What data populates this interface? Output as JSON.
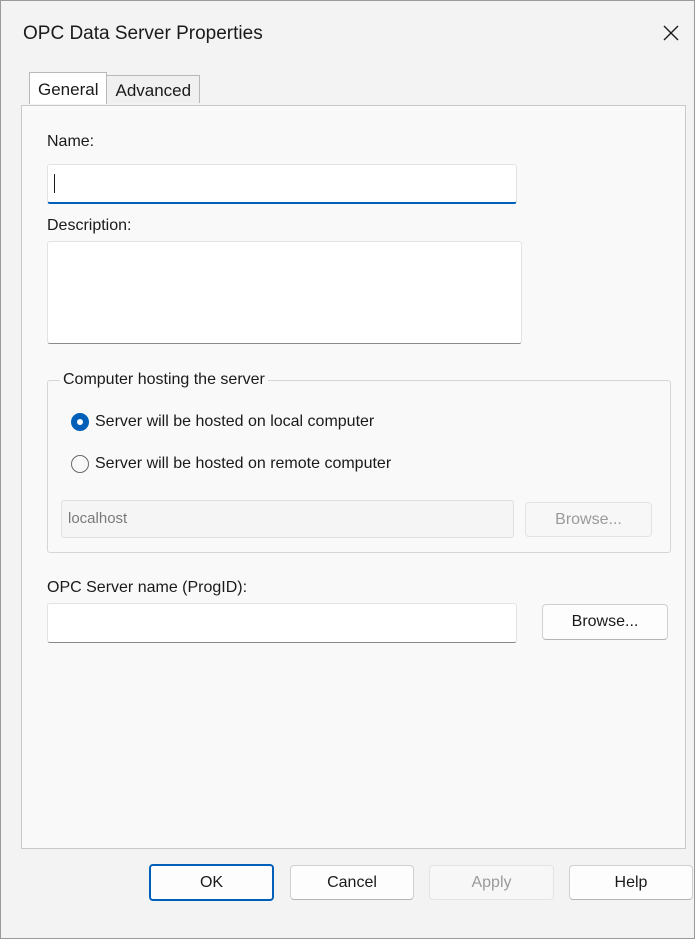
{
  "window": {
    "title": "OPC Data Server Properties",
    "close_glyph": "✕"
  },
  "tabs": [
    {
      "label": "General",
      "active": true
    },
    {
      "label": "Advanced",
      "active": false
    }
  ],
  "general": {
    "name_label": "Name:",
    "name_value": "",
    "description_label": "Description:",
    "description_value": "",
    "host_group": {
      "legend": "Computer hosting the server",
      "options": [
        {
          "label": "Server will be hosted on local computer",
          "selected": true
        },
        {
          "label": "Server will be hosted on remote computer",
          "selected": false
        }
      ],
      "computer_value": "localhost",
      "browse_label": "Browse..."
    },
    "progid_label": "OPC Server name (ProgID):",
    "progid_value": "",
    "progid_browse_label": "Browse..."
  },
  "footer": {
    "ok_label": "OK",
    "cancel_label": "Cancel",
    "apply_label": "Apply",
    "help_label": "Help"
  },
  "colors": {
    "accent": "#005fb8",
    "window_bg": "#f3f3f3",
    "panel_bg": "#f9f9f9"
  }
}
